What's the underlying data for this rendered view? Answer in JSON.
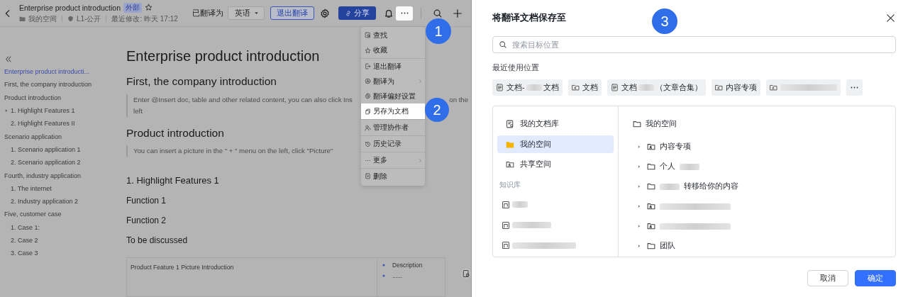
{
  "doc_view": {
    "header": {
      "title": "Enterprise product introduction",
      "badge": "外部",
      "starred": false,
      "location": "我的空间",
      "permission": "L1-公开",
      "modified": "最近修改: 昨天 17:12",
      "translated_label": "已翻译为",
      "language": "英语",
      "exit_translation": "退出翻译",
      "share": "分享"
    },
    "outline": [
      {
        "text": "Enterprise product introducti...",
        "selected": true,
        "collapsed": false
      },
      {
        "text": "First, the company introduction",
        "selected": false,
        "collapsed": false
      },
      {
        "text": "Product introduction",
        "selected": false,
        "collapsed": false,
        "children": [
          {
            "text": "1. Highlight Features 1",
            "selected": false,
            "collapsed": true
          },
          {
            "text": "2. Highlight Features II",
            "selected": false,
            "collapsed": false
          }
        ]
      },
      {
        "text": "Scenario application",
        "selected": false,
        "collapsed": false,
        "children": [
          {
            "text": "1. Scenario application 1",
            "selected": false,
            "collapsed": false
          },
          {
            "text": "2. Scenario application 2",
            "selected": false,
            "collapsed": false
          }
        ]
      },
      {
        "text": "Fourth, industry application",
        "selected": false,
        "collapsed": false,
        "children": [
          {
            "text": "1. The internet",
            "selected": false,
            "collapsed": false
          },
          {
            "text": "2. Industry application 2",
            "selected": false,
            "collapsed": false
          }
        ]
      },
      {
        "text": "Five, customer case",
        "selected": false,
        "collapsed": false,
        "children": [
          {
            "text": "1. Case 1:",
            "selected": false,
            "collapsed": false
          },
          {
            "text": "2. Case 2",
            "selected": false,
            "collapsed": false
          },
          {
            "text": "3. Case 3",
            "selected": false,
            "collapsed": false
          }
        ]
      }
    ],
    "content": [
      {
        "kind": "h1",
        "text": "Enterprise product introduction"
      },
      {
        "kind": "h2",
        "text": "First, the company introduction"
      },
      {
        "kind": "quote",
        "lines": [
          "Enter @Insert doc, table and other related content, you can also click Ins",
          "left"
        ],
        "tail": "on the"
      },
      {
        "kind": "h2",
        "text": "Product introduction"
      },
      {
        "kind": "quote",
        "lines": [
          "You can insert a picture in the \" + \" menu on the left, click \"Picture\""
        ]
      },
      {
        "kind": "h3",
        "text": "1. Highlight Features 1"
      },
      {
        "kind": "h4",
        "text": "Function 1"
      },
      {
        "kind": "h4",
        "text": "Function 2"
      },
      {
        "kind": "h4",
        "text": "To be discussed"
      },
      {
        "kind": "table",
        "cell": "Product Feature 1 Picture Introduction",
        "bullets": [
          "Description",
          "......"
        ]
      }
    ],
    "menu": [
      {
        "kind": "find",
        "label": "查找",
        "submenu": false,
        "selected": false,
        "divider_after": false
      },
      {
        "kind": "star",
        "label": "收藏",
        "submenu": false,
        "selected": false,
        "divider_after": true
      },
      {
        "kind": "exit",
        "label": "退出翻译",
        "submenu": false,
        "selected": false,
        "divider_after": false
      },
      {
        "kind": "translate",
        "label": "翻译为",
        "submenu": true,
        "selected": false,
        "divider_after": false
      },
      {
        "kind": "gear",
        "label": "翻译偏好设置",
        "submenu": false,
        "selected": false,
        "divider_after": false
      },
      {
        "kind": "copy",
        "label": "另存为文档",
        "submenu": false,
        "selected": true,
        "divider_after": true
      },
      {
        "kind": "people",
        "label": "管理协作者",
        "submenu": false,
        "selected": false,
        "divider_after": true
      },
      {
        "kind": "history",
        "label": "历史记录",
        "submenu": false,
        "selected": false,
        "divider_after": true
      },
      {
        "kind": "more",
        "label": "更多",
        "submenu": true,
        "selected": false,
        "divider_after": true
      },
      {
        "kind": "trash",
        "label": "删除",
        "submenu": false,
        "selected": false,
        "divider_after": false
      }
    ],
    "steps": [
      "1",
      "2"
    ]
  },
  "dialog": {
    "title": "将翻译文档保存至",
    "step": "3",
    "search": {
      "placeholder": "搜索目标位置"
    },
    "recent_label": "最近使用位置",
    "recent": [
      {
        "kind": "doc",
        "segments": [
          {
            "kind": "text",
            "text": "文档-"
          },
          {
            "kind": "blur"
          },
          {
            "kind": "text",
            "text": "文档"
          }
        ]
      },
      {
        "kind": "folder",
        "segments": [
          {
            "kind": "text",
            "text": "文档"
          }
        ]
      },
      {
        "kind": "doc",
        "segments": [
          {
            "kind": "text",
            "text": "文档"
          },
          {
            "kind": "blur"
          },
          {
            "kind": "text",
            "text": "（文章合集）"
          }
        ]
      },
      {
        "kind": "folder",
        "segments": [
          {
            "kind": "text",
            "text": "内容专项"
          }
        ]
      },
      {
        "kind": "folder",
        "segments": [
          {
            "kind": "blur"
          }
        ]
      }
    ],
    "sources": [
      {
        "kind": "library",
        "label": "我的文档库",
        "selected": false
      },
      {
        "kind": "space",
        "label": "我的空间",
        "selected": true
      },
      {
        "kind": "shared",
        "label": "共享空间",
        "selected": false
      },
      {
        "kind": "heading",
        "label": "知识库"
      },
      {
        "kind": "wiki"
      },
      {
        "kind": "wiki"
      },
      {
        "kind": "wiki"
      }
    ],
    "tree": {
      "label": "我的空间",
      "children": [
        {
          "kind": "shared",
          "segments": [
            {
              "kind": "text",
              "text": "内容专项"
            }
          ]
        },
        {
          "kind": "folder",
          "segments": [
            {
              "kind": "text",
              "text": "个人"
            },
            {
              "kind": "blur"
            }
          ]
        },
        {
          "kind": "folder",
          "segments": [
            {
              "kind": "blur"
            },
            {
              "kind": "text",
              "text": "转移给你的内容"
            }
          ]
        },
        {
          "kind": "shared",
          "segments": [
            {
              "kind": "blur"
            }
          ]
        },
        {
          "kind": "shared",
          "segments": [
            {
              "kind": "blur"
            }
          ]
        },
        {
          "kind": "folder",
          "segments": [
            {
              "kind": "text",
              "text": "团队"
            }
          ]
        }
      ]
    },
    "buttons": [
      {
        "kind": "secondary",
        "label": "取消"
      },
      {
        "kind": "primary",
        "label": "确定"
      }
    ]
  }
}
